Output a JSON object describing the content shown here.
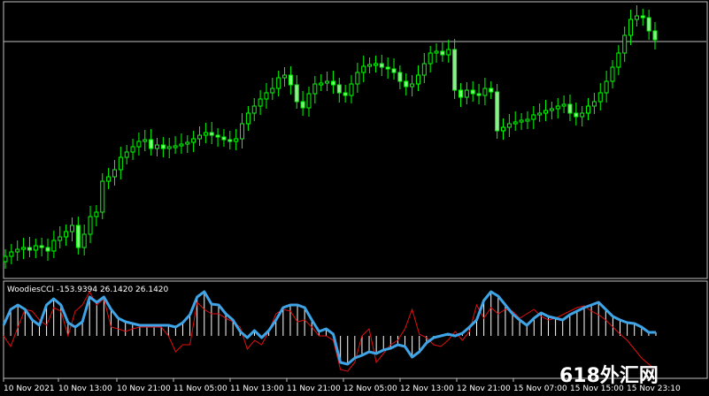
{
  "colors": {
    "background": "#000000",
    "bull_candle": "#00ff00",
    "bear_candle": "#00ff00",
    "body_fill_bear": "#90ee90",
    "cci_line": "#3ea4e6",
    "turbo_line": "#e01010",
    "histogram": "#ffffff",
    "border": "#c0c0c0"
  },
  "indicator": {
    "label": "WoodiesCCI -153.9394 26.1420 26.1420"
  },
  "time_axis": {
    "labels": [
      "10 Nov 2021",
      "10 Nov 13:00",
      "10 Nov 21:00",
      "11 Nov 05:00",
      "11 Nov 13:00",
      "11 Nov 21:00",
      "12 Nov 05:00",
      "12 Nov 13:00",
      "12 Nov 21:00",
      "15 Nov 07:00",
      "15 Nov 15:00",
      "15 Nov 23:10"
    ]
  },
  "watermark": {
    "text": "618外汇网"
  },
  "chart_data": [
    {
      "type": "candlestick",
      "panel": "price",
      "horizontal_line": true,
      "note": "close values (relative, no price axis shown)",
      "close": [
        290,
        285,
        282,
        280,
        283,
        278,
        280,
        284,
        272,
        268,
        262,
        255,
        280,
        265,
        245,
        240,
        205,
        200,
        192,
        178,
        172,
        166,
        160,
        158,
        168,
        164,
        168,
        166,
        165,
        163,
        161,
        157,
        153,
        150,
        153,
        155,
        158,
        160,
        157,
        140,
        128,
        120,
        112,
        105,
        100,
        88,
        85,
        96,
        115,
        122,
        106,
        95,
        94,
        92,
        96,
        105,
        108,
        95,
        82,
        75,
        73,
        72,
        76,
        78,
        82,
        92,
        98,
        95,
        85,
        72,
        60,
        58,
        62,
        56,
        102,
        110,
        102,
        106,
        108,
        100,
        104,
        148,
        144,
        140,
        138,
        136,
        135,
        130,
        128,
        125,
        123,
        120,
        118,
        128,
        132,
        128,
        120,
        115,
        105,
        92,
        76,
        60,
        40,
        22,
        18,
        20,
        35,
        45
      ]
    },
    {
      "type": "line",
      "panel": "indicator",
      "series": [
        {
          "name": "WoodiesCCI",
          "values": [
            368,
            350,
            345,
            350,
            362,
            368,
            345,
            338,
            345,
            365,
            370,
            364,
            336,
            342,
            336,
            350,
            360,
            364,
            366,
            368,
            368,
            368,
            368,
            368,
            370,
            365,
            356,
            336,
            330,
            344,
            345,
            355,
            362,
            375,
            382,
            374,
            382,
            374,
            362,
            348,
            345,
            345,
            348,
            362,
            375,
            372,
            378,
            410,
            412,
            405,
            402,
            398,
            400,
            396,
            394,
            390,
            392,
            404,
            398,
            388,
            382,
            380,
            378,
            380,
            377,
            370,
            362,
            340,
            330,
            335,
            345,
            355,
            362,
            368,
            360,
            354,
            358,
            360,
            362,
            356,
            352,
            348,
            345,
            342,
            350,
            358,
            362,
            365,
            366,
            370,
            376,
            376
          ]
        },
        {
          "name": "Turbo",
          "values": [
            380,
            392,
            370,
            350,
            352,
            362,
            368,
            348,
            352,
            380,
            352,
            345,
            330,
            345,
            338,
            370,
            372,
            375,
            372,
            370,
            370,
            370,
            370,
            380,
            398,
            390,
            390,
            342,
            350,
            355,
            355,
            360,
            364,
            370,
            395,
            385,
            390,
            375,
            355,
            350,
            352,
            364,
            362,
            370,
            380,
            380,
            385,
            418,
            420,
            410,
            380,
            372,
            410,
            400,
            390,
            385,
            372,
            350,
            378,
            382,
            390,
            392,
            385,
            375,
            385,
            375,
            345,
            360,
            348,
            355,
            350,
            352,
            360,
            355,
            350,
            358,
            362,
            360,
            356,
            352,
            348,
            346,
            352,
            356,
            362,
            370,
            378,
            385,
            395,
            405,
            412,
            418
          ]
        }
      ]
    }
  ]
}
